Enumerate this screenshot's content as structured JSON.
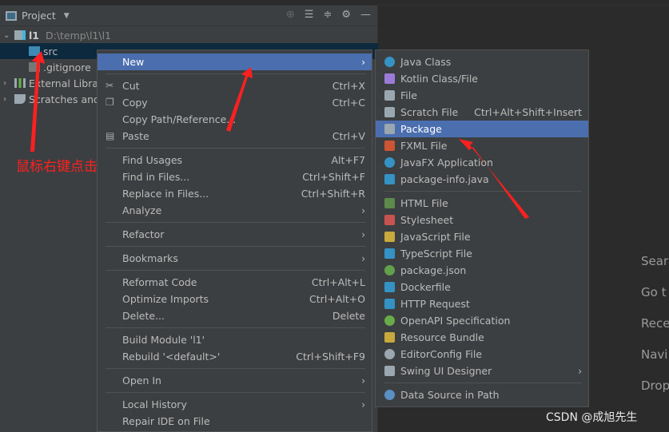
{
  "panel": {
    "title": "Project",
    "tools": [
      "locate-icon",
      "expand-all-icon",
      "collapse-all-icon",
      "gear-icon",
      "minimize-icon"
    ],
    "tree": [
      {
        "label": "l1",
        "path": "D:\\temp\\l1\\l1",
        "icon": "module-icon",
        "expanded": true
      },
      {
        "label": "src",
        "icon": "folder-icon",
        "selected": true
      },
      {
        "label": ".gitignore",
        "icon": "gitignore-icon"
      },
      {
        "label": "External Libraries",
        "icon": "library-icon"
      },
      {
        "label": "Scratches and Consoles",
        "icon": "scratches-icon"
      }
    ]
  },
  "context_menu": {
    "items": [
      {
        "label": "New",
        "arrow": true,
        "highlighted": true
      },
      {
        "sep": true
      },
      {
        "label": "Cut",
        "shortcut": "Ctrl+X",
        "icon": "scissors-icon"
      },
      {
        "label": "Copy",
        "shortcut": "Ctrl+C",
        "icon": "copy-icon"
      },
      {
        "label": "Copy Path/Reference..."
      },
      {
        "label": "Paste",
        "shortcut": "Ctrl+V",
        "icon": "paste-icon"
      },
      {
        "sep": true
      },
      {
        "label": "Find Usages",
        "shortcut": "Alt+F7"
      },
      {
        "label": "Find in Files...",
        "shortcut": "Ctrl+Shift+F"
      },
      {
        "label": "Replace in Files...",
        "shortcut": "Ctrl+Shift+R"
      },
      {
        "label": "Analyze",
        "arrow": true
      },
      {
        "sep": true
      },
      {
        "label": "Refactor",
        "arrow": true
      },
      {
        "sep": true
      },
      {
        "label": "Bookmarks",
        "arrow": true
      },
      {
        "sep": true
      },
      {
        "label": "Reformat Code",
        "shortcut": "Ctrl+Alt+L"
      },
      {
        "label": "Optimize Imports",
        "shortcut": "Ctrl+Alt+O"
      },
      {
        "label": "Delete...",
        "shortcut": "Delete"
      },
      {
        "sep": true
      },
      {
        "label": "Build Module 'l1'"
      },
      {
        "label": "Rebuild '<default>'",
        "shortcut": "Ctrl+Shift+F9"
      },
      {
        "sep": true
      },
      {
        "label": "Open In",
        "arrow": true
      },
      {
        "sep": true
      },
      {
        "label": "Local History",
        "arrow": true
      },
      {
        "label": "Repair IDE on File"
      }
    ]
  },
  "new_submenu": {
    "items": [
      {
        "label": "Java Class",
        "icon": "java-class-icon",
        "color": "#3592c4",
        "round": true
      },
      {
        "label": "Kotlin Class/File",
        "icon": "kotlin-icon",
        "color": "#9a7cd8"
      },
      {
        "label": "File",
        "icon": "file-icon",
        "color": "#9aa7b0"
      },
      {
        "label": "Scratch File",
        "shortcut": "Ctrl+Alt+Shift+Insert",
        "icon": "scratch-file-icon",
        "color": "#9aa7b0"
      },
      {
        "label": "Package",
        "icon": "package-icon",
        "color": "#9aa7b0",
        "highlighted": true
      },
      {
        "label": "FXML File",
        "icon": "fxml-icon",
        "color": "#cc5533"
      },
      {
        "label": "JavaFX Application",
        "icon": "javafx-icon",
        "color": "#3592c4",
        "round": true
      },
      {
        "label": "package-info.java",
        "icon": "package-info-icon",
        "color": "#3592c4"
      },
      {
        "sep": true
      },
      {
        "label": "HTML File",
        "icon": "html-icon",
        "color": "#5c8a4a"
      },
      {
        "label": "Stylesheet",
        "icon": "css-icon",
        "color": "#c75450"
      },
      {
        "label": "JavaScript File",
        "icon": "js-icon",
        "color": "#c9a83c"
      },
      {
        "label": "TypeScript File",
        "icon": "ts-icon",
        "color": "#3592c4"
      },
      {
        "label": "package.json",
        "icon": "npm-json-icon",
        "color": "#62a04d",
        "round": true
      },
      {
        "label": "Dockerfile",
        "icon": "docker-icon",
        "color": "#3592c4"
      },
      {
        "label": "HTTP Request",
        "icon": "http-icon",
        "color": "#3592c4"
      },
      {
        "label": "OpenAPI Specification",
        "icon": "openapi-icon",
        "color": "#6aab49",
        "round": true
      },
      {
        "label": "Resource Bundle",
        "icon": "resource-bundle-icon",
        "color": "#c9a83c"
      },
      {
        "label": "EditorConfig File",
        "icon": "editorconfig-icon",
        "color": "#9aa7b0",
        "round": true
      },
      {
        "label": "Swing UI Designer",
        "arrow": true,
        "icon": "swing-icon",
        "color": "#9aa7b0"
      },
      {
        "sep": true
      },
      {
        "label": "Data Source in Path",
        "icon": "database-icon",
        "color": "#5a8fc2",
        "round": true
      }
    ]
  },
  "editor_hints": [
    "Sear",
    "Go t",
    "Rece",
    "Navi",
    "Drop"
  ],
  "annotation": "鼠标右键点击",
  "watermark": "CSDN @成旭先生",
  "colors": {
    "highlight": "#4b6eaf",
    "selection": "#0d293e",
    "annotation": "#ff2020"
  }
}
